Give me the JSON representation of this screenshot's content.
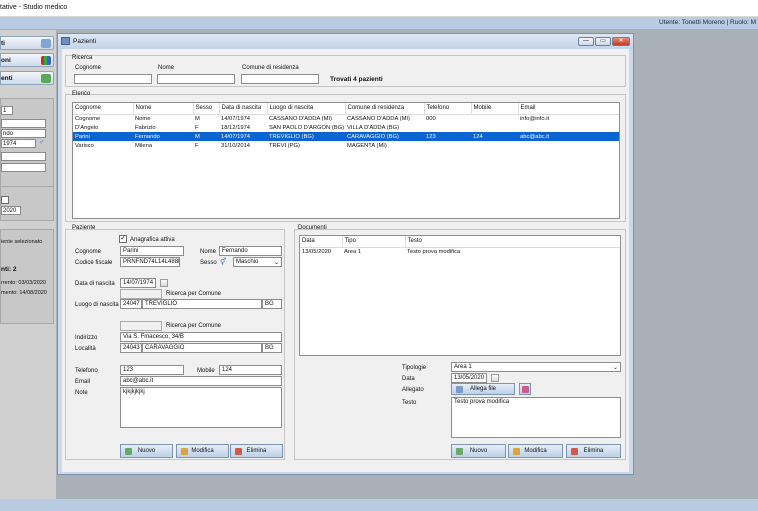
{
  "app": {
    "title": "tative - Studio medico",
    "user_line": "Utente: Tonetti Moreno | Ruolo: M"
  },
  "left": {
    "buttons": [
      {
        "label": "ti",
        "icon": "patients-icon"
      },
      {
        "label": "oni",
        "icon": "chart-icon"
      },
      {
        "label": "enti",
        "icon": "people-icon"
      }
    ],
    "filters": {
      "num": "1",
      "field2": "",
      "field3": "ndo",
      "date": "1974",
      "field5": "",
      "field6": "",
      "date2": "2020"
    },
    "info": {
      "line1": "iente selezionato",
      "count": "nti: 2",
      "line3": "rrento: 03/03/2020",
      "line4": "mento: 14/08/2020"
    }
  },
  "window": {
    "title": "Pazienti",
    "minimize": "—",
    "maximize": "▭",
    "close": "✕"
  },
  "search": {
    "group": "Ricerca",
    "cognome_label": "Cognome",
    "nome_label": "Nome",
    "comune_label": "Comune di residenza",
    "cognome": "",
    "nome": "",
    "comune": "",
    "found": "Trovati 4 pazienti"
  },
  "list": {
    "group": "Elenco",
    "columns": [
      "Cognome",
      "Nome",
      "Sesso",
      "Data di nascita",
      "Luogo di nascita",
      "Comune di residenza",
      "Telefono",
      "Mobile",
      "Email"
    ],
    "rows": [
      [
        "Cognome",
        "Nome",
        "M",
        "14/07/1974",
        "CASSANO D'ADDA (MI)",
        "CASSANO D'ADDA (MI)",
        "000",
        "",
        "info@info.it"
      ],
      [
        "D'Angelo",
        "Fabrizio",
        "F",
        "18/12/1974",
        "SAN PAOLO D'ARGON (BG)",
        "VILLA D'ADDA (BG)",
        "",
        "",
        ""
      ],
      [
        "Parini",
        "Fernando",
        "M",
        "14/07/1974",
        "TREVIGLIO (BG)",
        "CARAVAGGIO (BG)",
        "123",
        "124",
        "abc@abc.it"
      ],
      [
        "Varisco",
        "Milena",
        "F",
        "31/10/2014",
        "TREVI (PG)",
        "MAGENTA (MI)",
        "",
        "",
        ""
      ]
    ],
    "selected": 2
  },
  "patient": {
    "group": "Paziente",
    "active_label": "Anagrafica attiva",
    "cognome_label": "Cognome",
    "cognome": "Parini",
    "nome_label": "Nome",
    "nome": "Fernando",
    "cf_label": "Codice fiscale",
    "cf": "PRNFND74L14L488D",
    "sesso_label": "Sesso",
    "sesso": "Maschio",
    "nascita_label": "Data di nascita",
    "nascita": "14/07/1974",
    "ricerca_comune": "Ricerca per Comune",
    "luogo_label": "Luogo di nascita",
    "luogo_cap": "24047",
    "luogo": "TREVIGLIO",
    "luogo_prov": "BG",
    "ricerca_comune2": "Ricerca per Comune",
    "indirizzo_label": "Indirizzo",
    "indirizzo": "Via S. Fmacesco, 34/B",
    "localita_label": "Località",
    "localita_cap": "24043",
    "localita": "CARAVAGGIO",
    "localita_prov": "BG",
    "telefono_label": "Telefono",
    "telefono": "123",
    "mobile_label": "Mobile",
    "mobile": "124",
    "email_label": "Email",
    "email": "abc@abc.it",
    "note_label": "Note",
    "note": "kjkjkjkjkj",
    "btn_new": "Nuovo",
    "btn_edit": "Modifica",
    "btn_delete": "Elimina"
  },
  "documents": {
    "group": "Documenti",
    "columns": [
      "Data",
      "Tipo",
      "Testo"
    ],
    "rows": [
      [
        "13/05/2020",
        "Area 1",
        "Testo prova modifica"
      ]
    ],
    "tipologie_label": "Tipologie",
    "tipologie": "Area 1",
    "data_label": "Data",
    "data": "13/05/2020",
    "allegato_label": "Allegato",
    "allega_btn": "Allega file",
    "testo_label": "Testo",
    "testo": "Testo prova modifica",
    "btn_new": "Nuovo",
    "btn_edit": "Modifica",
    "btn_delete": "Elimina"
  },
  "colors": {
    "accent": "#0a64d2",
    "window_frame": "#cdd9e8",
    "desktop": "#aab0b8"
  }
}
